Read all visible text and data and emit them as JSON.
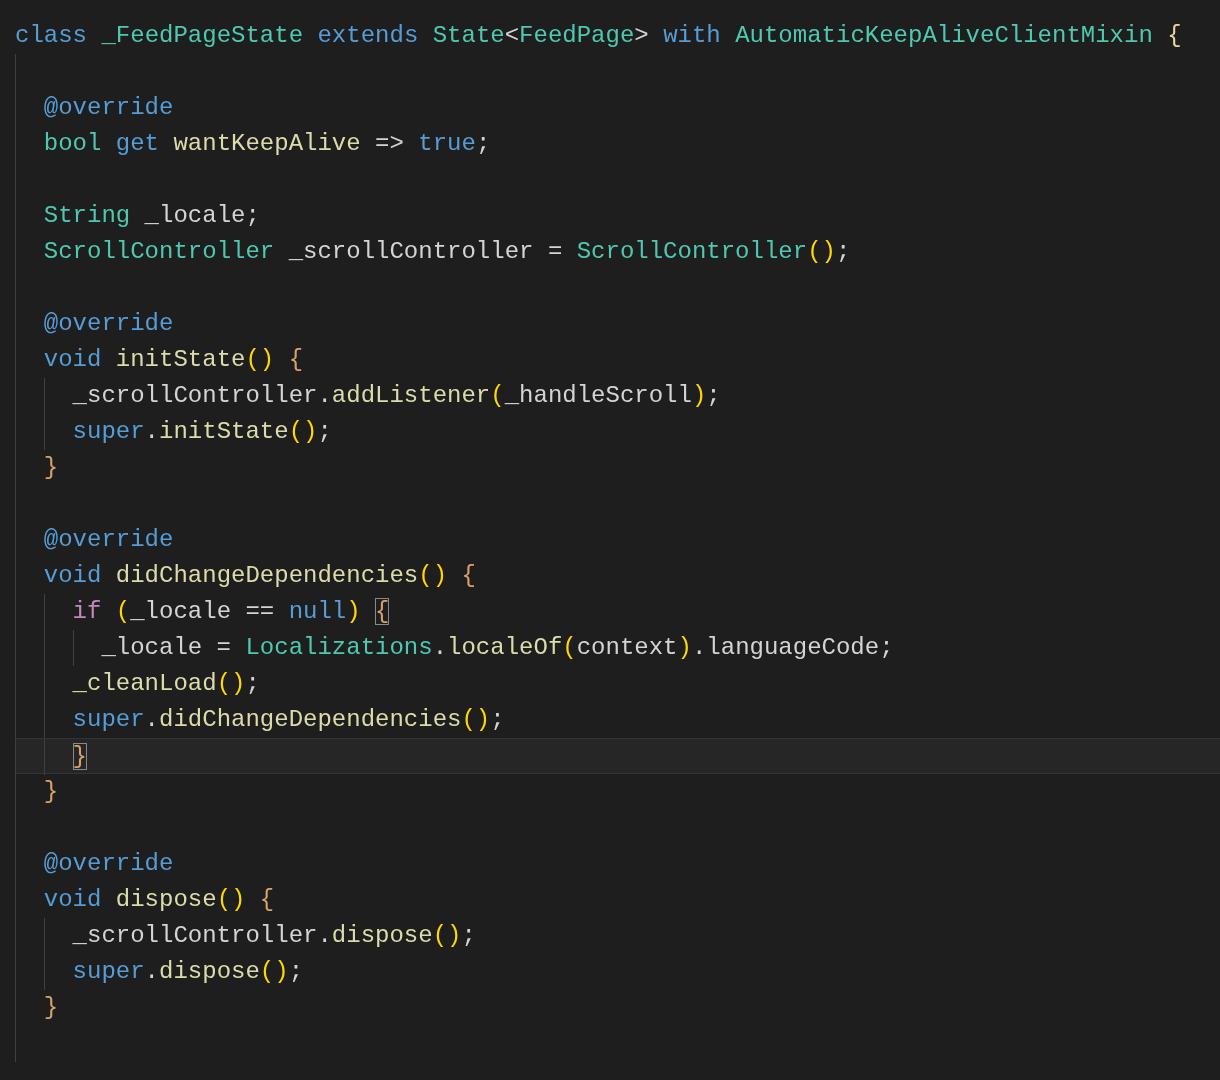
{
  "editor": {
    "lines": [
      {
        "kind": "code",
        "tokens": [
          {
            "text": "class ",
            "kind": "keyword"
          },
          {
            "text": "_FeedPageState",
            "kind": "type"
          },
          {
            "text": " extends ",
            "kind": "keyword"
          },
          {
            "text": "State",
            "kind": "type"
          },
          {
            "text": "<",
            "kind": "plain"
          },
          {
            "text": "FeedPage",
            "kind": "type"
          },
          {
            "text": ">",
            "kind": "plain"
          },
          {
            "text": " with ",
            "kind": "keyword"
          },
          {
            "text": "AutomaticKeepAliveClientMixin",
            "kind": "type"
          },
          {
            "text": " {",
            "kind": "brace"
          }
        ],
        "children": [
          {
            "kind": "blank"
          },
          {
            "kind": "code",
            "tokens": [
              {
                "text": "@override",
                "kind": "keyword"
              }
            ]
          },
          {
            "kind": "code",
            "tokens": [
              {
                "text": "bool",
                "kind": "type"
              },
              {
                "text": " get ",
                "kind": "keyword"
              },
              {
                "text": "wantKeepAlive",
                "kind": "function"
              },
              {
                "text": " => ",
                "kind": "plain"
              },
              {
                "text": "true",
                "kind": "keyword"
              },
              {
                "text": ";",
                "kind": "plain"
              }
            ]
          },
          {
            "kind": "blank"
          },
          {
            "kind": "code",
            "tokens": [
              {
                "text": "String",
                "kind": "type"
              },
              {
                "text": " _locale;",
                "kind": "plain"
              }
            ]
          },
          {
            "kind": "code",
            "tokens": [
              {
                "text": "ScrollController",
                "kind": "type"
              },
              {
                "text": " _scrollController = ",
                "kind": "plain"
              },
              {
                "text": "ScrollController",
                "kind": "type"
              },
              {
                "text": "()",
                "kind": "paren"
              },
              {
                "text": ";",
                "kind": "plain"
              }
            ]
          },
          {
            "kind": "blank"
          },
          {
            "kind": "code",
            "tokens": [
              {
                "text": "@override",
                "kind": "keyword"
              }
            ]
          },
          {
            "kind": "code",
            "tokens": [
              {
                "text": "void",
                "kind": "keyword"
              },
              {
                "text": " initState",
                "kind": "function"
              },
              {
                "text": "()",
                "kind": "paren"
              },
              {
                "text": " {",
                "kind": "method-brace"
              }
            ],
            "children": [
              {
                "kind": "code",
                "tokens": [
                  {
                    "text": "_scrollController.",
                    "kind": "plain"
                  },
                  {
                    "text": "addListener",
                    "kind": "function"
                  },
                  {
                    "text": "(",
                    "kind": "paren"
                  },
                  {
                    "text": "_handleScroll",
                    "kind": "plain"
                  },
                  {
                    "text": ")",
                    "kind": "paren"
                  },
                  {
                    "text": ";",
                    "kind": "plain"
                  }
                ]
              },
              {
                "kind": "code",
                "tokens": [
                  {
                    "text": "super",
                    "kind": "keyword"
                  },
                  {
                    "text": ".",
                    "kind": "plain"
                  },
                  {
                    "text": "initState",
                    "kind": "function"
                  },
                  {
                    "text": "()",
                    "kind": "paren"
                  },
                  {
                    "text": ";",
                    "kind": "plain"
                  }
                ]
              }
            ]
          },
          {
            "kind": "code",
            "tokens": [
              {
                "text": "}",
                "kind": "method-brace"
              }
            ]
          },
          {
            "kind": "blank"
          },
          {
            "kind": "code",
            "tokens": [
              {
                "text": "@override",
                "kind": "keyword"
              }
            ]
          },
          {
            "kind": "code",
            "tokens": [
              {
                "text": "void",
                "kind": "keyword"
              },
              {
                "text": " didChangeDependencies",
                "kind": "function"
              },
              {
                "text": "()",
                "kind": "paren"
              },
              {
                "text": " {",
                "kind": "method-brace"
              }
            ],
            "children": [
              {
                "kind": "code",
                "tokens": [
                  {
                    "text": "if ",
                    "kind": "control"
                  },
                  {
                    "text": "(",
                    "kind": "paren"
                  },
                  {
                    "text": "_locale == ",
                    "kind": "plain"
                  },
                  {
                    "text": "null",
                    "kind": "keyword"
                  },
                  {
                    "text": ") ",
                    "kind": "paren"
                  },
                  {
                    "text": "{",
                    "kind": "inner-brace",
                    "matched": true
                  }
                ],
                "children": [
                  {
                    "kind": "code",
                    "tokens": [
                      {
                        "text": "_locale = ",
                        "kind": "plain"
                      },
                      {
                        "text": "Localizations",
                        "kind": "type"
                      },
                      {
                        "text": ".",
                        "kind": "plain"
                      },
                      {
                        "text": "localeOf",
                        "kind": "function"
                      },
                      {
                        "text": "(",
                        "kind": "paren"
                      },
                      {
                        "text": "context",
                        "kind": "plain"
                      },
                      {
                        "text": ")",
                        "kind": "paren"
                      },
                      {
                        "text": ".languageCode;",
                        "kind": "plain"
                      }
                    ]
                  }
                ]
              },
              {
                "kind": "code",
                "tokens": [
                  {
                    "text": "_cleanLoad",
                    "kind": "function"
                  },
                  {
                    "text": "()",
                    "kind": "paren"
                  },
                  {
                    "text": ";",
                    "kind": "plain"
                  }
                ]
              },
              {
                "kind": "code",
                "tokens": [
                  {
                    "text": "super",
                    "kind": "keyword"
                  },
                  {
                    "text": ".",
                    "kind": "plain"
                  },
                  {
                    "text": "didChangeDependencies",
                    "kind": "function"
                  },
                  {
                    "text": "()",
                    "kind": "paren"
                  },
                  {
                    "text": ";",
                    "kind": "plain"
                  }
                ]
              },
              {
                "kind": "code",
                "current": true,
                "tokens": [
                  {
                    "text": "}",
                    "kind": "inner-brace",
                    "matched": true
                  }
                ]
              }
            ]
          },
          {
            "kind": "code",
            "tokens": [
              {
                "text": "}",
                "kind": "method-brace"
              }
            ]
          },
          {
            "kind": "blank"
          },
          {
            "kind": "code",
            "tokens": [
              {
                "text": "@override",
                "kind": "keyword"
              }
            ]
          },
          {
            "kind": "code",
            "tokens": [
              {
                "text": "void",
                "kind": "keyword"
              },
              {
                "text": " dispose",
                "kind": "function"
              },
              {
                "text": "()",
                "kind": "paren"
              },
              {
                "text": " {",
                "kind": "method-brace"
              }
            ],
            "children": [
              {
                "kind": "code",
                "tokens": [
                  {
                    "text": "_scrollController.",
                    "kind": "plain"
                  },
                  {
                    "text": "dispose",
                    "kind": "function"
                  },
                  {
                    "text": "()",
                    "kind": "paren"
                  },
                  {
                    "text": ";",
                    "kind": "plain"
                  }
                ]
              },
              {
                "kind": "code",
                "tokens": [
                  {
                    "text": "super",
                    "kind": "keyword"
                  },
                  {
                    "text": ".",
                    "kind": "plain"
                  },
                  {
                    "text": "dispose",
                    "kind": "function"
                  },
                  {
                    "text": "()",
                    "kind": "paren"
                  },
                  {
                    "text": ";",
                    "kind": "plain"
                  }
                ]
              }
            ]
          },
          {
            "kind": "code",
            "tokens": [
              {
                "text": "}",
                "kind": "method-brace"
              }
            ]
          },
          {
            "kind": "blank"
          }
        ]
      }
    ]
  }
}
